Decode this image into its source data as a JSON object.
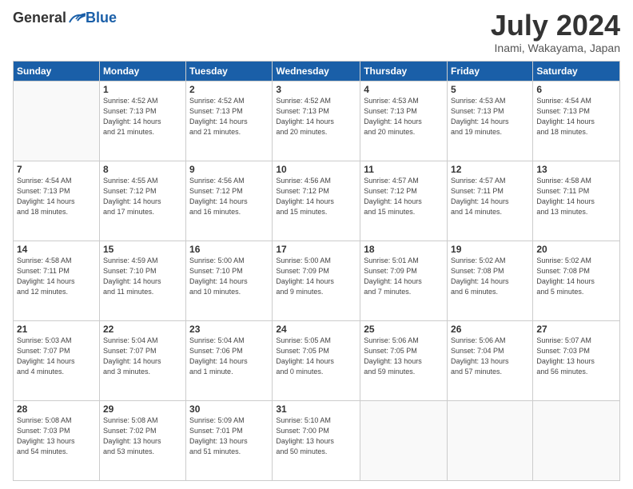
{
  "header": {
    "logo": {
      "general": "General",
      "blue": "Blue"
    },
    "title": "July 2024",
    "subtitle": "Inami, Wakayama, Japan"
  },
  "days_of_week": [
    "Sunday",
    "Monday",
    "Tuesday",
    "Wednesday",
    "Thursday",
    "Friday",
    "Saturday"
  ],
  "weeks": [
    [
      {
        "day": "",
        "info": ""
      },
      {
        "day": "1",
        "info": "Sunrise: 4:52 AM\nSunset: 7:13 PM\nDaylight: 14 hours\nand 21 minutes."
      },
      {
        "day": "2",
        "info": "Sunrise: 4:52 AM\nSunset: 7:13 PM\nDaylight: 14 hours\nand 21 minutes."
      },
      {
        "day": "3",
        "info": "Sunrise: 4:52 AM\nSunset: 7:13 PM\nDaylight: 14 hours\nand 20 minutes."
      },
      {
        "day": "4",
        "info": "Sunrise: 4:53 AM\nSunset: 7:13 PM\nDaylight: 14 hours\nand 20 minutes."
      },
      {
        "day": "5",
        "info": "Sunrise: 4:53 AM\nSunset: 7:13 PM\nDaylight: 14 hours\nand 19 minutes."
      },
      {
        "day": "6",
        "info": "Sunrise: 4:54 AM\nSunset: 7:13 PM\nDaylight: 14 hours\nand 18 minutes."
      }
    ],
    [
      {
        "day": "7",
        "info": "Sunrise: 4:54 AM\nSunset: 7:13 PM\nDaylight: 14 hours\nand 18 minutes."
      },
      {
        "day": "8",
        "info": "Sunrise: 4:55 AM\nSunset: 7:12 PM\nDaylight: 14 hours\nand 17 minutes."
      },
      {
        "day": "9",
        "info": "Sunrise: 4:56 AM\nSunset: 7:12 PM\nDaylight: 14 hours\nand 16 minutes."
      },
      {
        "day": "10",
        "info": "Sunrise: 4:56 AM\nSunset: 7:12 PM\nDaylight: 14 hours\nand 15 minutes."
      },
      {
        "day": "11",
        "info": "Sunrise: 4:57 AM\nSunset: 7:12 PM\nDaylight: 14 hours\nand 15 minutes."
      },
      {
        "day": "12",
        "info": "Sunrise: 4:57 AM\nSunset: 7:11 PM\nDaylight: 14 hours\nand 14 minutes."
      },
      {
        "day": "13",
        "info": "Sunrise: 4:58 AM\nSunset: 7:11 PM\nDaylight: 14 hours\nand 13 minutes."
      }
    ],
    [
      {
        "day": "14",
        "info": "Sunrise: 4:58 AM\nSunset: 7:11 PM\nDaylight: 14 hours\nand 12 minutes."
      },
      {
        "day": "15",
        "info": "Sunrise: 4:59 AM\nSunset: 7:10 PM\nDaylight: 14 hours\nand 11 minutes."
      },
      {
        "day": "16",
        "info": "Sunrise: 5:00 AM\nSunset: 7:10 PM\nDaylight: 14 hours\nand 10 minutes."
      },
      {
        "day": "17",
        "info": "Sunrise: 5:00 AM\nSunset: 7:09 PM\nDaylight: 14 hours\nand 9 minutes."
      },
      {
        "day": "18",
        "info": "Sunrise: 5:01 AM\nSunset: 7:09 PM\nDaylight: 14 hours\nand 7 minutes."
      },
      {
        "day": "19",
        "info": "Sunrise: 5:02 AM\nSunset: 7:08 PM\nDaylight: 14 hours\nand 6 minutes."
      },
      {
        "day": "20",
        "info": "Sunrise: 5:02 AM\nSunset: 7:08 PM\nDaylight: 14 hours\nand 5 minutes."
      }
    ],
    [
      {
        "day": "21",
        "info": "Sunrise: 5:03 AM\nSunset: 7:07 PM\nDaylight: 14 hours\nand 4 minutes."
      },
      {
        "day": "22",
        "info": "Sunrise: 5:04 AM\nSunset: 7:07 PM\nDaylight: 14 hours\nand 3 minutes."
      },
      {
        "day": "23",
        "info": "Sunrise: 5:04 AM\nSunset: 7:06 PM\nDaylight: 14 hours\nand 1 minute."
      },
      {
        "day": "24",
        "info": "Sunrise: 5:05 AM\nSunset: 7:05 PM\nDaylight: 14 hours\nand 0 minutes."
      },
      {
        "day": "25",
        "info": "Sunrise: 5:06 AM\nSunset: 7:05 PM\nDaylight: 13 hours\nand 59 minutes."
      },
      {
        "day": "26",
        "info": "Sunrise: 5:06 AM\nSunset: 7:04 PM\nDaylight: 13 hours\nand 57 minutes."
      },
      {
        "day": "27",
        "info": "Sunrise: 5:07 AM\nSunset: 7:03 PM\nDaylight: 13 hours\nand 56 minutes."
      }
    ],
    [
      {
        "day": "28",
        "info": "Sunrise: 5:08 AM\nSunset: 7:03 PM\nDaylight: 13 hours\nand 54 minutes."
      },
      {
        "day": "29",
        "info": "Sunrise: 5:08 AM\nSunset: 7:02 PM\nDaylight: 13 hours\nand 53 minutes."
      },
      {
        "day": "30",
        "info": "Sunrise: 5:09 AM\nSunset: 7:01 PM\nDaylight: 13 hours\nand 51 minutes."
      },
      {
        "day": "31",
        "info": "Sunrise: 5:10 AM\nSunset: 7:00 PM\nDaylight: 13 hours\nand 50 minutes."
      },
      {
        "day": "",
        "info": ""
      },
      {
        "day": "",
        "info": ""
      },
      {
        "day": "",
        "info": ""
      }
    ]
  ]
}
